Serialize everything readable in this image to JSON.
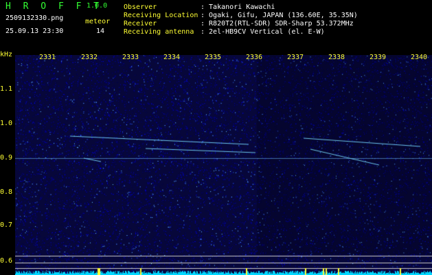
{
  "header": {
    "app_name": "H R O F F T",
    "version": "1.0.0",
    "file_name": "2509132330.png",
    "date_time": "25.09.13 23:30",
    "meteor_label": "meteor",
    "meteor_count": "14"
  },
  "metadata": [
    {
      "key": "Observer",
      "value": ": Takanori Kawachi"
    },
    {
      "key": "Receiving Location",
      "value": ": Ogaki, Gifu, JAPAN (136.60E, 35.35N)"
    },
    {
      "key": "Receiver",
      "value": ": R820T2(RTL-SDR) SDR-Sharp 53.372MHz"
    },
    {
      "key": "Receiving antenna",
      "value": ": 2el-HB9CV Vertical (el. E-W)"
    }
  ],
  "axes": {
    "y_unit": "kHz",
    "x_ticks": [
      "2331",
      "2332",
      "2333",
      "2334",
      "2335",
      "2336",
      "2337",
      "2338",
      "2339",
      "2340"
    ],
    "y_ticks": [
      "1.1",
      "1.0",
      "0.9",
      "0.8",
      "0.7",
      "0.6"
    ]
  },
  "colors": {
    "background": "#000000",
    "spectrogram_base": "#0a0a3c",
    "title_green": "#33ff33",
    "label_yellow": "#ffff33",
    "value_white": "#ffffff",
    "trace_cyan": "#00e5ff"
  }
}
